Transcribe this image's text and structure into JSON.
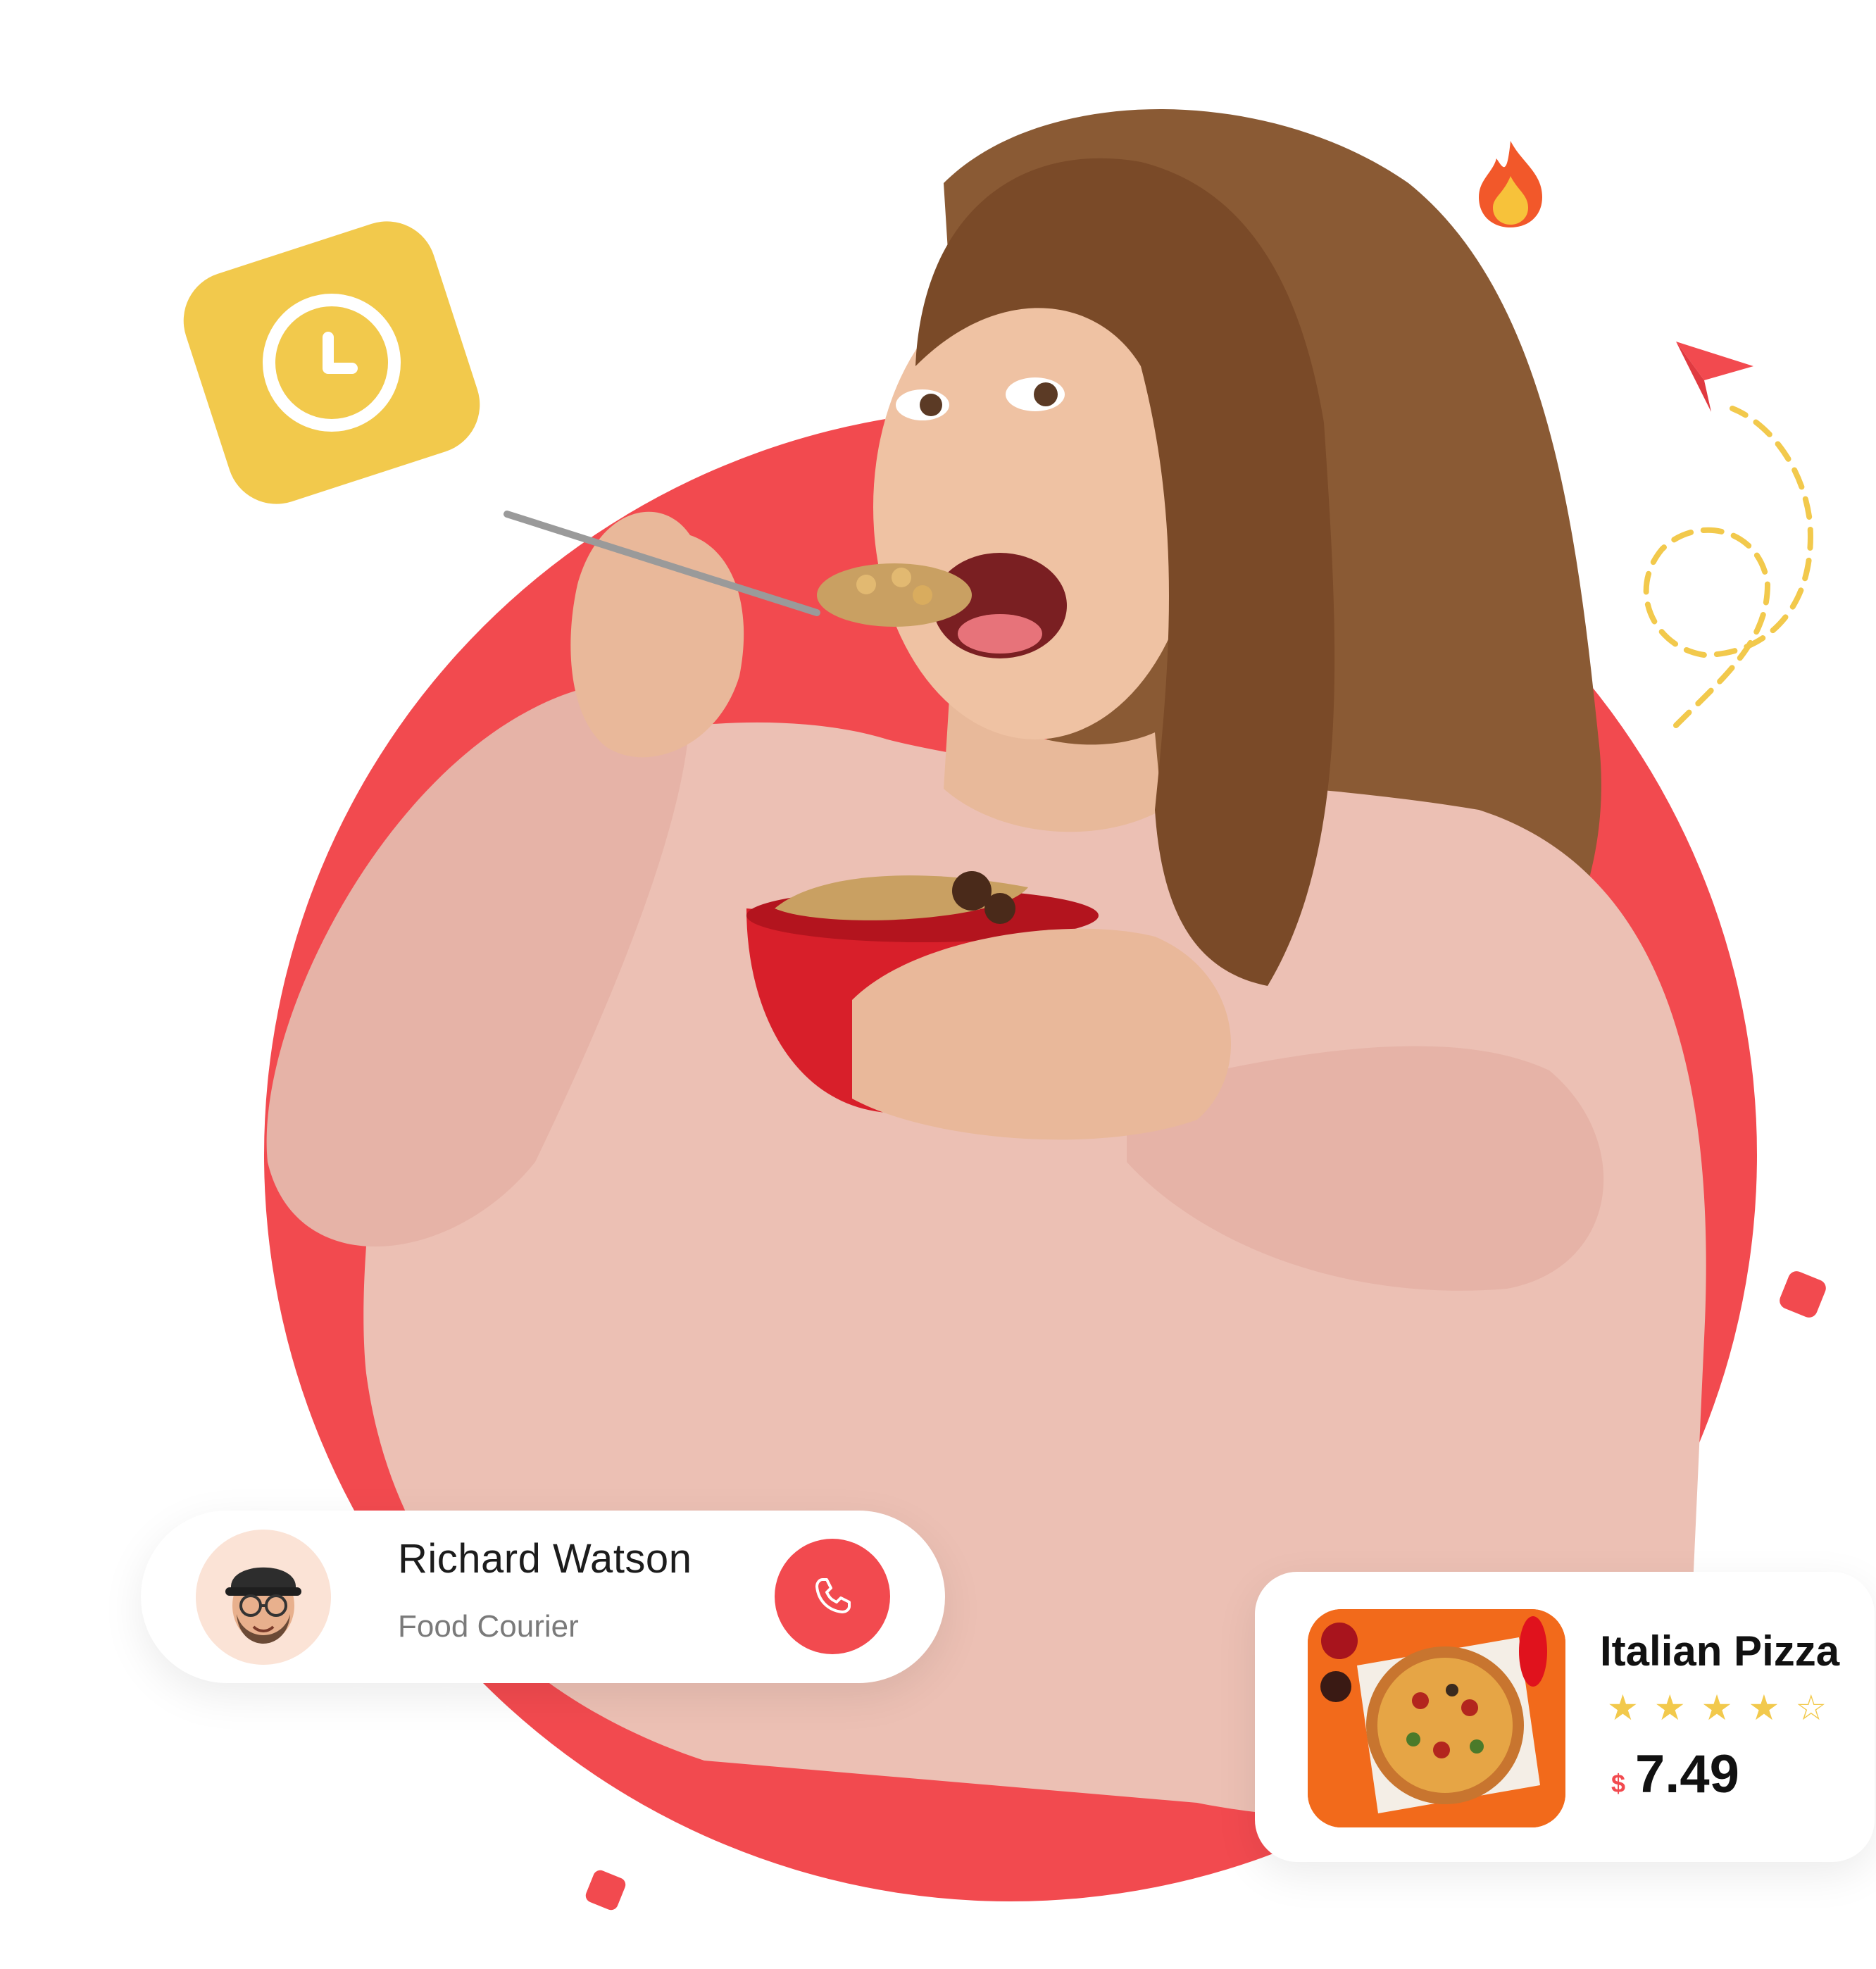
{
  "colors": {
    "accent_red": "#f24a4f",
    "accent_yellow": "#f2c94c",
    "sweater_pink": "#ecc0b4",
    "hair_brown": "#8a5a34"
  },
  "icons": {
    "clock": "clock-icon",
    "fire": "fire-icon",
    "plane": "paper-plane-icon",
    "phone": "phone-icon"
  },
  "courier": {
    "name": "Richard Watson",
    "role": "Food Courier"
  },
  "product": {
    "name": "Italian Pizza",
    "rating": 4,
    "rating_max": 5,
    "currency": "$",
    "price": "7.49"
  }
}
